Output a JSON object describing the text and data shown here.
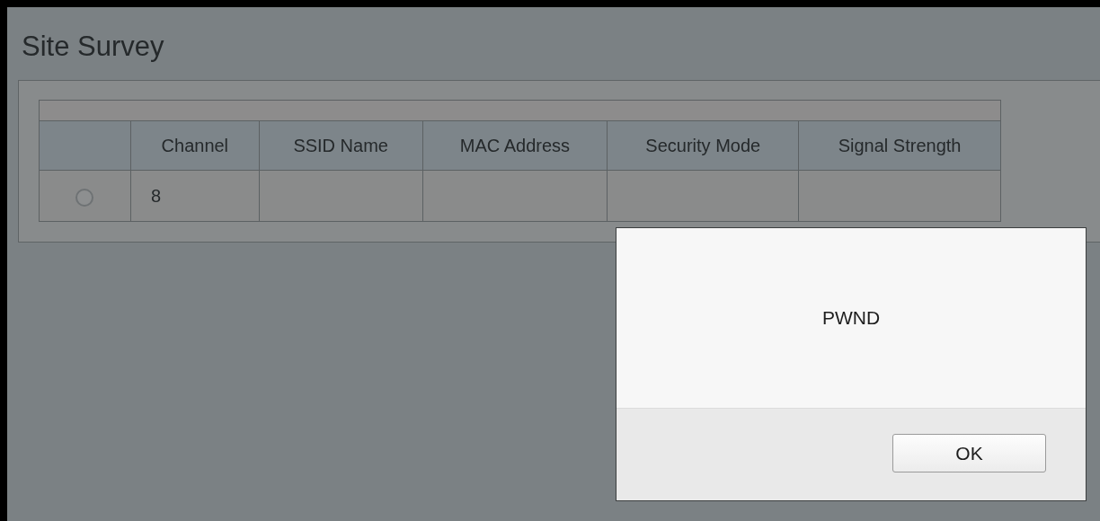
{
  "page": {
    "title": "Site Survey"
  },
  "table": {
    "columns": [
      "Channel",
      "SSID Name",
      "MAC Address",
      "Security Mode",
      "Signal Strength"
    ],
    "rows": [
      {
        "selected": false,
        "cells": [
          "8"
        ]
      }
    ]
  },
  "dialog": {
    "message": "PWND",
    "buttons": [
      "OK"
    ]
  }
}
